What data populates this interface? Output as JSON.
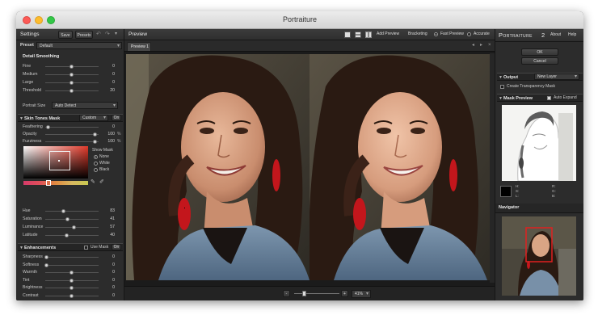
{
  "window": {
    "title": "Portraiture"
  },
  "left_panel": {
    "header": "Settings",
    "save_label": "Save",
    "presets_label": "Presets",
    "preset_label": "Preset",
    "preset_value": "Default",
    "detail_smoothing": {
      "title": "Detail Smoothing",
      "sliders": [
        {
          "label": "Fine",
          "value": "0",
          "fraction": 0.5
        },
        {
          "label": "Medium",
          "value": "0",
          "fraction": 0.5
        },
        {
          "label": "Large",
          "value": "0",
          "fraction": 0.5
        },
        {
          "label": "Threshold",
          "value": "20",
          "fraction": 0.5
        }
      ],
      "portrait_size_label": "Portrait Size",
      "portrait_size_value": "Auto Detect"
    },
    "skin_tones": {
      "title": "Skin Tones Mask",
      "mode_value": "Custom",
      "on_label": "On",
      "sliders": [
        {
          "label": "Feathering",
          "value": "0",
          "unit": "",
          "fraction": 0.04
        },
        {
          "label": "Opacity",
          "value": "100",
          "unit": "%",
          "fraction": 0.95
        },
        {
          "label": "Fuzziness",
          "value": "100",
          "unit": "%",
          "fraction": 0.95
        }
      ],
      "show_mask_label": "Show Mask",
      "show_mask_options": [
        "None",
        "White",
        "Black"
      ],
      "show_mask_selected": "None",
      "hsl_sliders": [
        {
          "label": "Hue",
          "value": "83",
          "fraction": 0.35
        },
        {
          "label": "Saturation",
          "value": "41",
          "fraction": 0.42
        },
        {
          "label": "Luminance",
          "value": "57",
          "fraction": 0.55
        },
        {
          "label": "Latitude",
          "value": "40",
          "fraction": 0.4
        }
      ]
    },
    "enhancements": {
      "title": "Enhancements",
      "use_mask_label": "Use Mask",
      "on_label": "On",
      "sliders": [
        {
          "label": "Sharpness",
          "value": "0",
          "fraction": 0.02
        },
        {
          "label": "Softness",
          "value": "0",
          "fraction": 0.02
        },
        {
          "label": "Warmth",
          "value": "0",
          "fraction": 0.5
        },
        {
          "label": "Tint",
          "value": "0",
          "fraction": 0.5
        },
        {
          "label": "Brightness",
          "value": "0",
          "fraction": 0.5
        },
        {
          "label": "Contrast",
          "value": "0",
          "fraction": 0.5
        }
      ]
    }
  },
  "center_panel": {
    "header": "Preview",
    "add_preview_label": "Add Preview",
    "bracketing_label": "Bracketing",
    "fast_preview_label": "Fast Preview",
    "accurate_label": "Accurate",
    "preview_mode": "Fast Preview",
    "tab_label": "Preview 1",
    "zoom_value": "41%",
    "zoom_minus": "-",
    "zoom_plus": "+"
  },
  "right_panel": {
    "brand_main": "Portraiture",
    "brand_version": "2",
    "about_label": "About",
    "help_label": "Help",
    "ok_label": "OK",
    "cancel_label": "Cancel",
    "output_title": "Output",
    "output_value": "New Layer",
    "create_transparency_label": "Create Transparency Mask",
    "mask_preview_title": "Mask Preview",
    "auto_expand_label": "Auto Expand",
    "color_readout": {
      "left": [
        "H:",
        "S:",
        "L:"
      ],
      "right": [
        "R:",
        "G:",
        "B:"
      ]
    },
    "navigator_title": "Navigator"
  },
  "colors": {
    "panel_bg": "#2c2c2c",
    "viewer_bg": "#1b1b1b",
    "highlight_red": "#d62020"
  }
}
